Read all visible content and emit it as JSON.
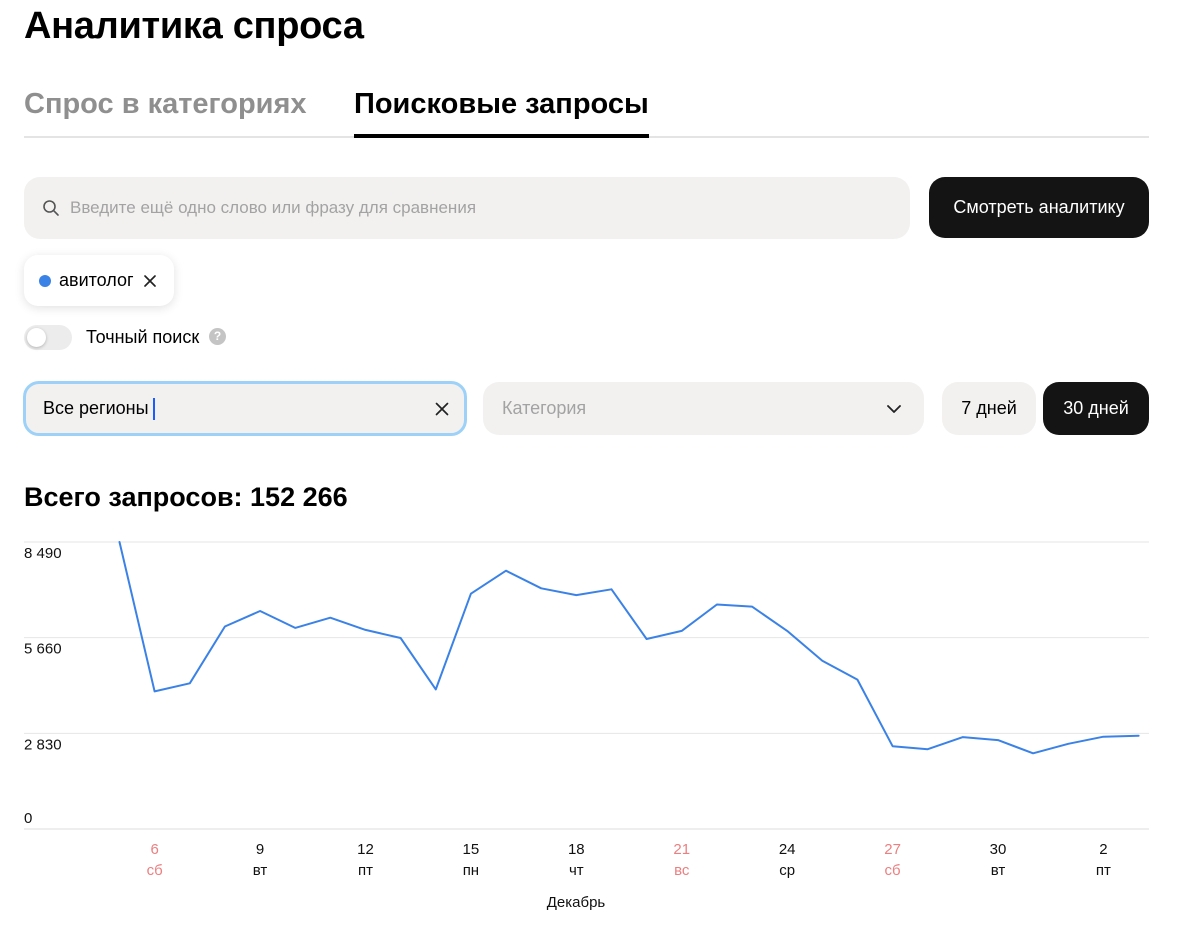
{
  "page": {
    "title": "Аналитика спроса"
  },
  "tabs": [
    {
      "label": "Спрос в категориях",
      "active": false
    },
    {
      "label": "Поисковые запросы",
      "active": true
    }
  ],
  "search": {
    "placeholder": "Введите ещё одно слово или фразу для сравнения",
    "value": "",
    "icon": "search-icon"
  },
  "actions": {
    "view_analytics_label": "Смотреть аналитику"
  },
  "chips": [
    {
      "label": "авитолог",
      "color": "#3b82e6"
    }
  ],
  "exact_search": {
    "label": "Точный поиск",
    "enabled": false,
    "help_glyph": "?"
  },
  "filters": {
    "region_value": "Все регионы",
    "category_placeholder": "Категория",
    "periods": [
      {
        "label": "7 дней",
        "active": false
      },
      {
        "label": "30 дней",
        "active": true
      }
    ]
  },
  "summary": {
    "total_label": "Всего запросов: 152 266"
  },
  "colors": {
    "accent": "#3b82e6",
    "weekend": "#ec7f80",
    "button_dark": "#141414",
    "field_bg": "#f2f1f0",
    "focus_ring": "#9dd1f8"
  },
  "chart_data": {
    "type": "line",
    "xlabel": "Декабрь",
    "ylabel": "",
    "ylim": [
      0,
      8490
    ],
    "yticks": [
      {
        "value": 8490,
        "label": "8 490"
      },
      {
        "value": 5660,
        "label": "5 660"
      },
      {
        "value": 2830,
        "label": "2 830"
      },
      {
        "value": 0,
        "label": "0"
      }
    ],
    "grid": true,
    "xticks": [
      {
        "day": 6,
        "label": "6",
        "weekday": "сб",
        "weekend": true
      },
      {
        "day": 9,
        "label": "9",
        "weekday": "вт",
        "weekend": false
      },
      {
        "day": 12,
        "label": "12",
        "weekday": "пт",
        "weekend": false
      },
      {
        "day": 15,
        "label": "15",
        "weekday": "пн",
        "weekend": false
      },
      {
        "day": 18,
        "label": "18",
        "weekday": "чт",
        "weekend": false
      },
      {
        "day": 21,
        "label": "21",
        "weekday": "вс",
        "weekend": true
      },
      {
        "day": 24,
        "label": "24",
        "weekday": "ср",
        "weekend": false
      },
      {
        "day": 27,
        "label": "27",
        "weekday": "сб",
        "weekend": true
      },
      {
        "day": 30,
        "label": "30",
        "weekday": "вт",
        "weekend": false
      },
      {
        "day": 33,
        "label": "2",
        "weekday": "пт",
        "weekend": false
      }
    ],
    "series": [
      {
        "color": "#3b82e6",
        "x": [
          5,
          6,
          7,
          8,
          9,
          10,
          11,
          12,
          13,
          14,
          15,
          16,
          17,
          18,
          19,
          20,
          21,
          22,
          23,
          24,
          25,
          26,
          27,
          28,
          29,
          30,
          31,
          32,
          33,
          34
        ],
        "values": [
          8490,
          4070,
          4310,
          5990,
          6450,
          5950,
          6250,
          5890,
          5650,
          4130,
          6960,
          7640,
          7120,
          6920,
          7090,
          5620,
          5860,
          6640,
          6580,
          5860,
          4980,
          4420,
          2450,
          2360,
          2720,
          2630,
          2240,
          2520,
          2730,
          2760
        ]
      }
    ]
  }
}
